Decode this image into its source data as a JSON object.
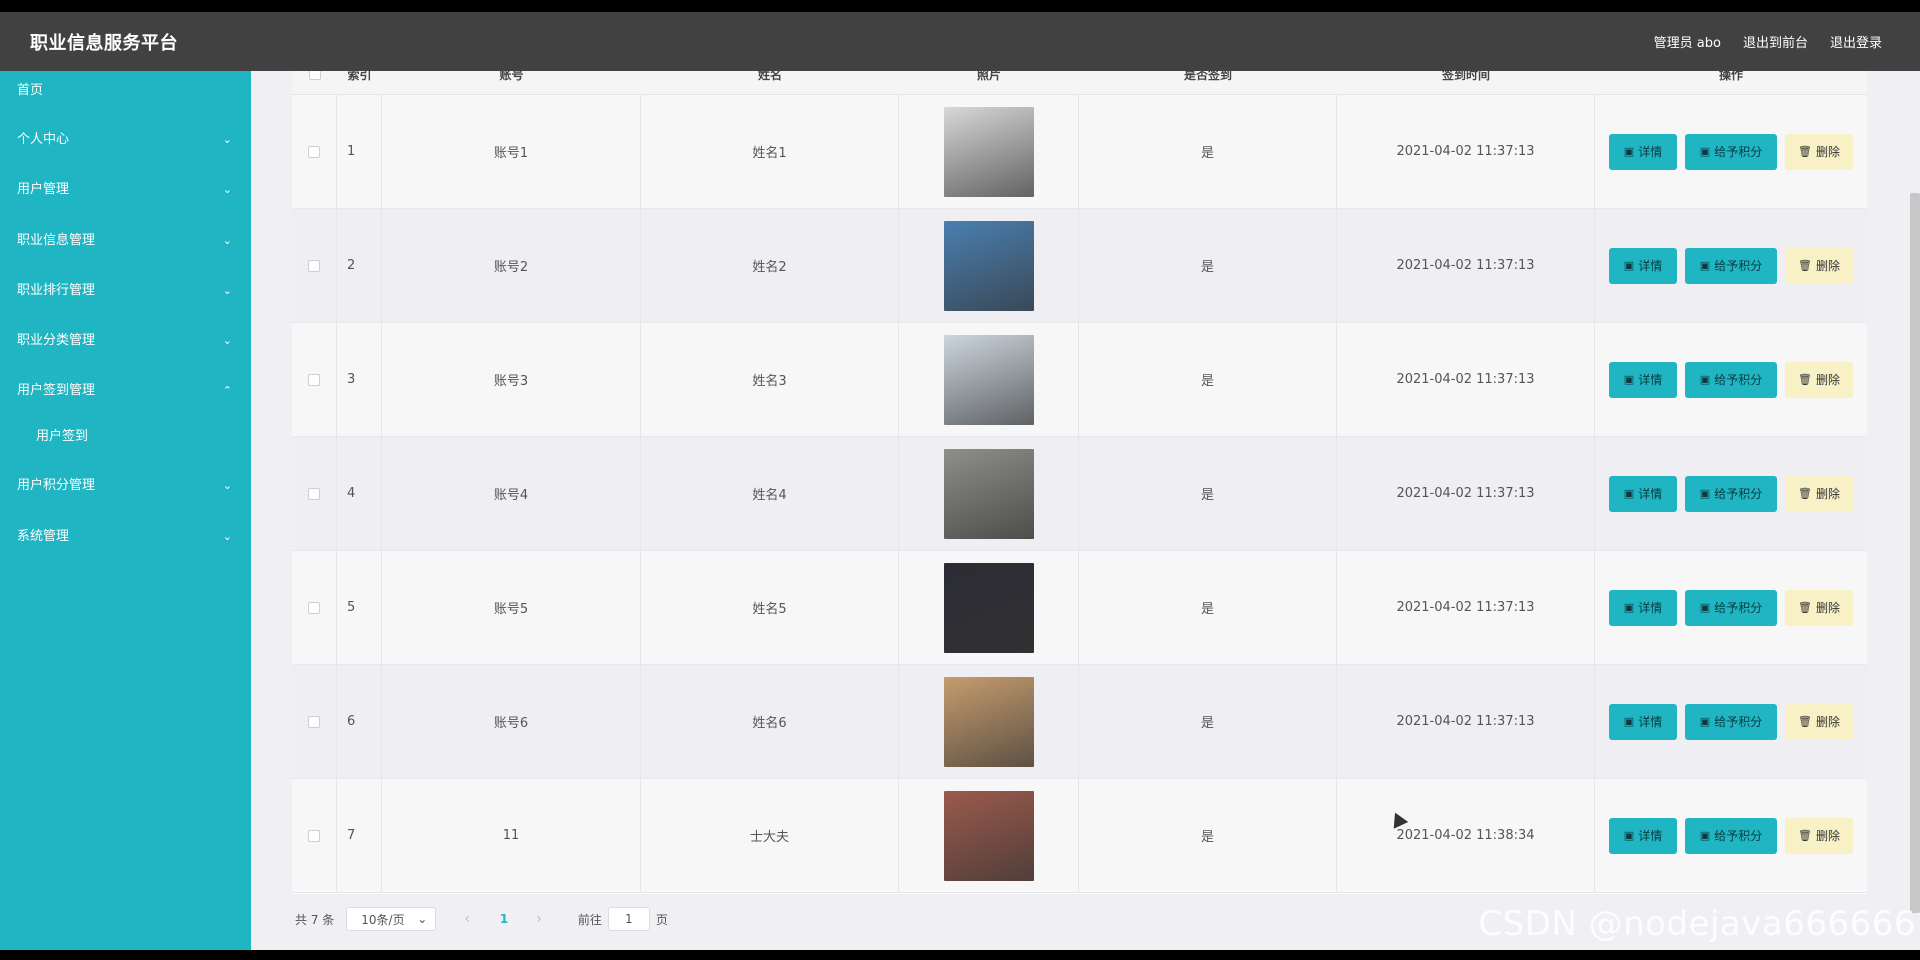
{
  "header": {
    "title": "职业信息服务平台",
    "links": [
      "管理员 abo",
      "退出到前台",
      "退出登录"
    ]
  },
  "sidebar": {
    "items": [
      {
        "label": "首页",
        "chevron": ""
      },
      {
        "label": "个人中心",
        "chevron": "⌄"
      },
      {
        "label": "用户管理",
        "chevron": "⌄"
      },
      {
        "label": "职业信息管理",
        "chevron": "⌄"
      },
      {
        "label": "职业排行管理",
        "chevron": "⌄"
      },
      {
        "label": "职业分类管理",
        "chevron": "⌄"
      },
      {
        "label": "用户签到管理",
        "chevron": "⌃"
      },
      {
        "label": "用户签到",
        "chevron": ""
      },
      {
        "label": "用户积分管理",
        "chevron": "⌄"
      },
      {
        "label": "系统管理",
        "chevron": "⌄"
      }
    ]
  },
  "table": {
    "headers": [
      "索引",
      "账号",
      "姓名",
      "照片",
      "是否签到",
      "签到时间",
      "操作"
    ],
    "rows": [
      {
        "index": "1",
        "account": "账号1",
        "name": "姓名1",
        "signed": "是",
        "time": "2021-04-02 11:37:13",
        "photo_color": "#d8d8d8"
      },
      {
        "index": "2",
        "account": "账号2",
        "name": "姓名2",
        "signed": "是",
        "time": "2021-04-02 11:37:13",
        "photo_color": "#4a7fb0"
      },
      {
        "index": "3",
        "account": "账号3",
        "name": "姓名3",
        "signed": "是",
        "time": "2021-04-02 11:37:13",
        "photo_color": "#cdd6de"
      },
      {
        "index": "4",
        "account": "账号4",
        "name": "姓名4",
        "signed": "是",
        "time": "2021-04-02 11:37:13",
        "photo_color": "#8e8e8a"
      },
      {
        "index": "5",
        "account": "账号5",
        "name": "姓名5",
        "signed": "是",
        "time": "2021-04-02 11:37:13",
        "photo_color": "#2c2c34"
      },
      {
        "index": "6",
        "account": "账号6",
        "name": "姓名6",
        "signed": "是",
        "time": "2021-04-02 11:37:13",
        "photo_color": "#c69c6e"
      },
      {
        "index": "7",
        "account": "11",
        "name": "士大夫",
        "signed": "是",
        "time": "2021-04-02 11:38:34",
        "photo_color": "#9b5a4c"
      }
    ],
    "actions": {
      "detail": "详情",
      "points": "给予积分",
      "delete": "删除"
    }
  },
  "pager": {
    "total": "共 7 条",
    "page_size": "10条/页",
    "current": "1",
    "goto_label": "前往",
    "goto_value": "1",
    "goto_suffix": "页"
  },
  "watermark": "CSDN @nodejava666666",
  "colors": {
    "accent": "#1fb5c3",
    "header": "#414141",
    "delete_bg": "#f8f1c6"
  }
}
